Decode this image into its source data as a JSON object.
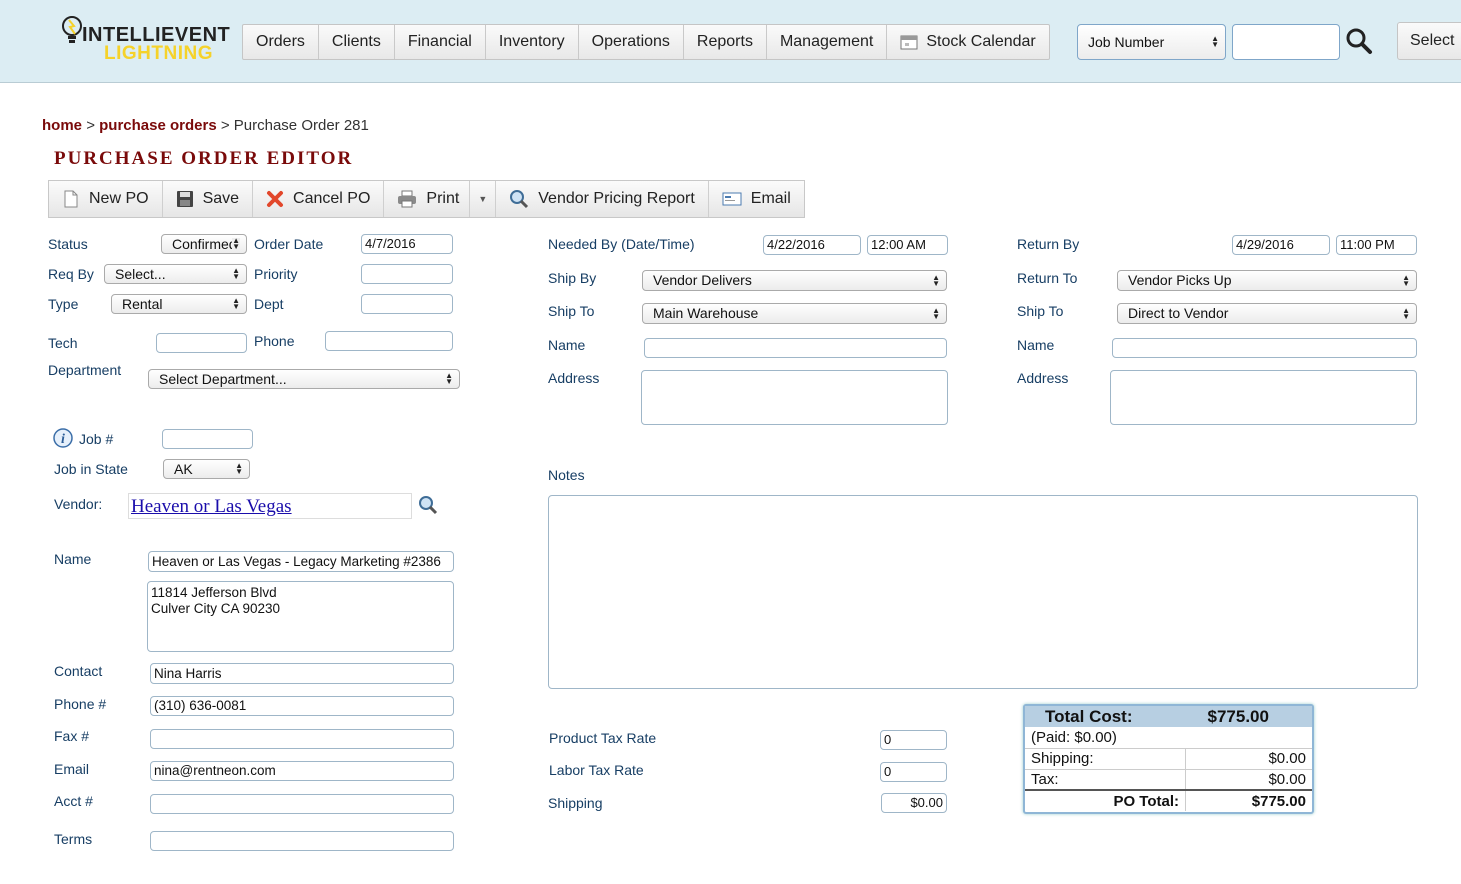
{
  "logo": {
    "line1": "INTELLIEVENT",
    "line2": "LIGHTNING"
  },
  "nav": {
    "items": [
      "Orders",
      "Clients",
      "Financial",
      "Inventory",
      "Operations",
      "Reports",
      "Management",
      "Stock Calendar"
    ],
    "search_type": "Job Number",
    "search_value": "",
    "select_label": "Select"
  },
  "breadcrumb": {
    "home": "home",
    "sep": ">",
    "purchase_orders": "purchase orders",
    "current": "Purchase Order 281"
  },
  "page_title": "PURCHASE ORDER EDITOR",
  "toolbar": {
    "new_po": "New PO",
    "save": "Save",
    "cancel_po": "Cancel PO",
    "print": "Print",
    "vendor_pricing_report": "Vendor Pricing Report",
    "email": "Email"
  },
  "left": {
    "status_label": "Status",
    "status_value": "Confirmed",
    "order_date_label": "Order Date",
    "order_date_value": "4/7/2016",
    "req_by_label": "Req By",
    "req_by_value": "Select...",
    "priority_label": "Priority",
    "priority_value": "",
    "type_label": "Type",
    "type_value": "Rental",
    "dept_label": "Dept",
    "dept_value": "",
    "tech_label": "Tech",
    "tech_value": "",
    "phone_label": "Phone",
    "phone_value": "",
    "department_label": "Department",
    "department_value": "Select Department...",
    "job_label": "Job #",
    "job_value": "",
    "job_state_label": "Job in State",
    "job_state_value": "AK",
    "vendor_label": "Vendor:",
    "vendor_value": "Heaven or Las Vegas",
    "name_label": "Name",
    "name_value": "Heaven or Las Vegas - Legacy Marketing #2386",
    "address_line1": "11814 Jefferson Blvd",
    "address_line2": "Culver City CA 90230",
    "contact_label": "Contact",
    "contact_value": "Nina Harris",
    "phone2_label": "Phone #",
    "phone2_value": "(310) 636-0081",
    "fax_label": "Fax #",
    "fax_value": "",
    "email_label": "Email",
    "email_value": "nina@rentneon.com",
    "acct_label": "Acct #",
    "acct_value": "",
    "terms_label": "Terms",
    "terms_value": ""
  },
  "middle": {
    "needed_by_label": "Needed By (Date/Time)",
    "needed_date": "4/22/2016",
    "needed_time": "12:00 AM",
    "ship_by_label": "Ship By",
    "ship_by_value": "Vendor Delivers",
    "ship_to_label": "Ship To",
    "ship_to_value": "Main Warehouse",
    "name_label": "Name",
    "name_value": "",
    "address_label": "Address",
    "address_value": "",
    "notes_label": "Notes",
    "notes_value": "",
    "product_tax_label": "Product Tax Rate",
    "product_tax_value": "0",
    "labor_tax_label": "Labor Tax Rate",
    "labor_tax_value": "0",
    "shipping_label": "Shipping",
    "shipping_value": "$0.00"
  },
  "right": {
    "return_by_label": "Return By",
    "return_date": "4/29/2016",
    "return_time": "11:00 PM",
    "return_to_label": "Return To",
    "return_to_value": "Vendor Picks Up",
    "ship_to_label": "Ship To",
    "ship_to_value": "Direct to Vendor",
    "name_label": "Name",
    "name_value": "",
    "address_label": "Address",
    "address_value": ""
  },
  "totals": {
    "total_cost_label": "Total Cost:",
    "total_cost_value": "$775.00",
    "paid": "(Paid: $0.00)",
    "shipping_label": "Shipping:",
    "shipping_value": "$0.00",
    "tax_label": "Tax:",
    "tax_value": "$0.00",
    "po_total_label": "PO Total:",
    "po_total_value": "$775.00"
  },
  "colors": {
    "header_bg": "#dcedf3",
    "brand_red": "#7a0a0a",
    "label_blue": "#173e64",
    "link_blue": "#1a0dab",
    "logo_yellow": "#f5d22a"
  }
}
